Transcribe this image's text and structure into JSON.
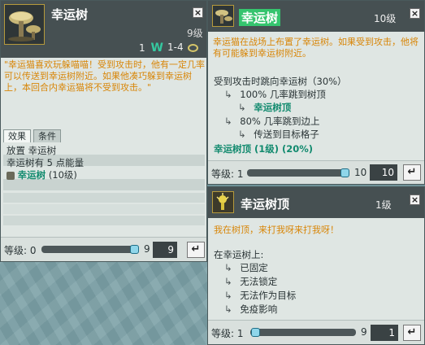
{
  "left_panel": {
    "title": "幸运树",
    "level_label": "9级",
    "stats": {
      "wp": "1",
      "range": "1-4"
    },
    "description": "\"幸运猫喜欢玩躲喵喵！受到攻击时，他有一定几率可以传送到幸运树附近。如果他凑巧躲到幸运树上，本回合内幸运猫将不受到攻击。\"",
    "tabs": [
      "效果",
      "条件"
    ],
    "effects": [
      "放置 幸运树",
      "幸运树有 5 点能量"
    ],
    "summon_name": "幸运树",
    "summon_level": "(10级)",
    "footer": {
      "label": "等级: 0",
      "max": "9",
      "value": "9",
      "progress": 1.0
    }
  },
  "right_top_panel": {
    "title": "幸运树",
    "level_label": "10级",
    "description": "幸运猫在战场上布置了幸运树。如果受到攻击，他将有可能躲到幸运树附近。",
    "trigger": "受到攻击时跳向幸运树（30%）",
    "branch1": "100% 几率跳到树顶",
    "branch1_sub": "幸运树顶",
    "branch2": "80% 几率跳到边上",
    "branch2_sub": "传送到目标格子",
    "summary": "幸运树顶 (1级) (20%)",
    "footer": {
      "label": "等级: 1",
      "max": "10",
      "value": "10",
      "progress": 1.0
    }
  },
  "right_bottom_panel": {
    "title": "幸运树顶",
    "level_label": "1级",
    "description": "我在树顶，来打我呀来打我呀！",
    "on_tree": "在幸运树上:",
    "states": [
      "已固定",
      "无法锁定",
      "无法作为目标",
      "免疫影响"
    ],
    "footer": {
      "label": "等级: 1",
      "max": "9",
      "value": "1",
      "progress": 0.0
    }
  },
  "icons": {
    "close": "×",
    "enter": "↵",
    "arrow": "↳",
    "wp": "W"
  },
  "colors": {
    "header": "#465052",
    "panel_bg": "#dfe6e3",
    "description": "#d88608",
    "highlight": "#118a6e"
  }
}
